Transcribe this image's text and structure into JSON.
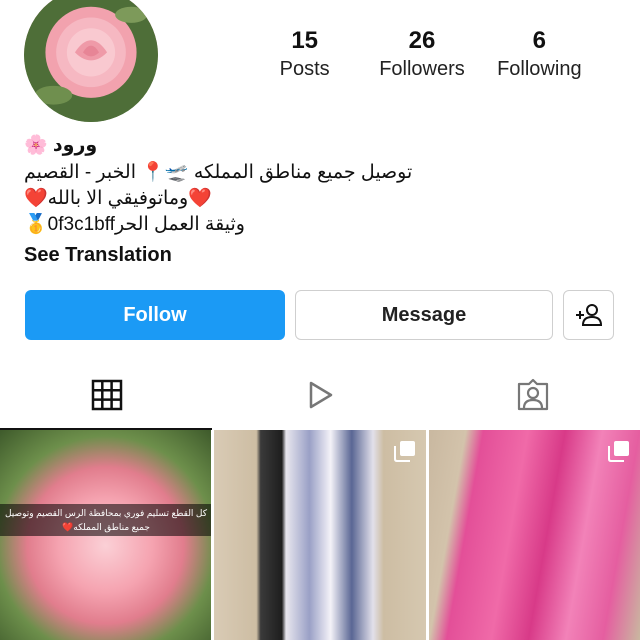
{
  "profile": {
    "avatar_icon": "rose-photo",
    "display_name": "ورود 🌸",
    "bio_lines": [
      "توصيل جميع مناطق المملكه 🛫📍 الخبر - القصيم",
      "❤️وماتوفيقي الا بالله❤️",
      "وثيقة العمل الحر0f3c1bff🥇"
    ],
    "see_translation": "See Translation"
  },
  "stats": [
    {
      "value": "15",
      "label": "Posts"
    },
    {
      "value": "26",
      "label": "Followers"
    },
    {
      "value": "6",
      "label": "Following"
    }
  ],
  "actions": {
    "follow_label": "Follow",
    "message_label": "Message",
    "add_user_icon": "add-user-icon"
  },
  "tabs": [
    {
      "icon": "grid-icon",
      "active": true
    },
    {
      "icon": "reels-play-icon",
      "active": false
    },
    {
      "icon": "tagged-person-icon",
      "active": false
    }
  ],
  "posts": [
    {
      "caption": "كل القطع تسليم فوري بمحافظة الرس القصيم   وتوصيل جميع مناطق المملكه❤️"
    },
    {
      "caption": ""
    },
    {
      "caption": ""
    }
  ],
  "colors": {
    "follow_button": "#1b9af5",
    "active_tab": "#111111"
  }
}
